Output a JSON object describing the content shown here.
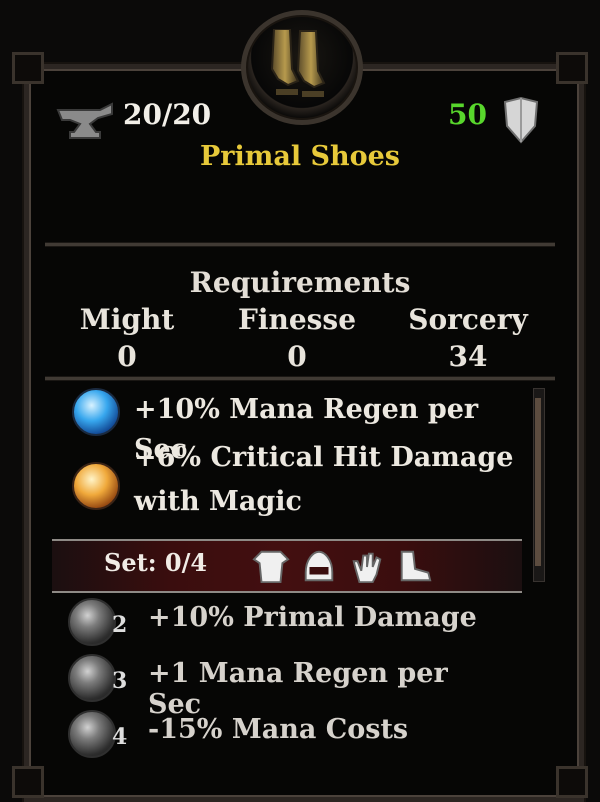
{
  "item": {
    "durability": "20/20",
    "armor": "50",
    "name": "Primal Shoes",
    "icon": "boots-icon"
  },
  "requirements": {
    "title": "Requirements",
    "stats": [
      {
        "name": "Might",
        "value": "0"
      },
      {
        "name": "Finesse",
        "value": "0"
      },
      {
        "name": "Sorcery",
        "value": "34"
      }
    ]
  },
  "affixes": [
    {
      "line1": "+10% Mana Regen per Sec",
      "line2": "",
      "icon": "blue-orb-icon"
    },
    {
      "line1": "+6% Critical Hit Damage",
      "line2": "with Magic",
      "icon": "orange-orb-icon"
    }
  ],
  "set": {
    "label": "Set: 0/4",
    "pieces": [
      "chest-armor-icon",
      "helmet-icon",
      "glove-icon",
      "boot-icon"
    ],
    "bonuses": [
      {
        "count": "2",
        "text": "+10% Primal Damage"
      },
      {
        "count": "3",
        "text": "+1 Mana Regen per Sec"
      },
      {
        "count": "4",
        "text": "-15% Mana Costs"
      }
    ]
  },
  "colors": {
    "title": "#e7c93a",
    "armor": "#58d62c",
    "set_bar": "#430f10"
  }
}
